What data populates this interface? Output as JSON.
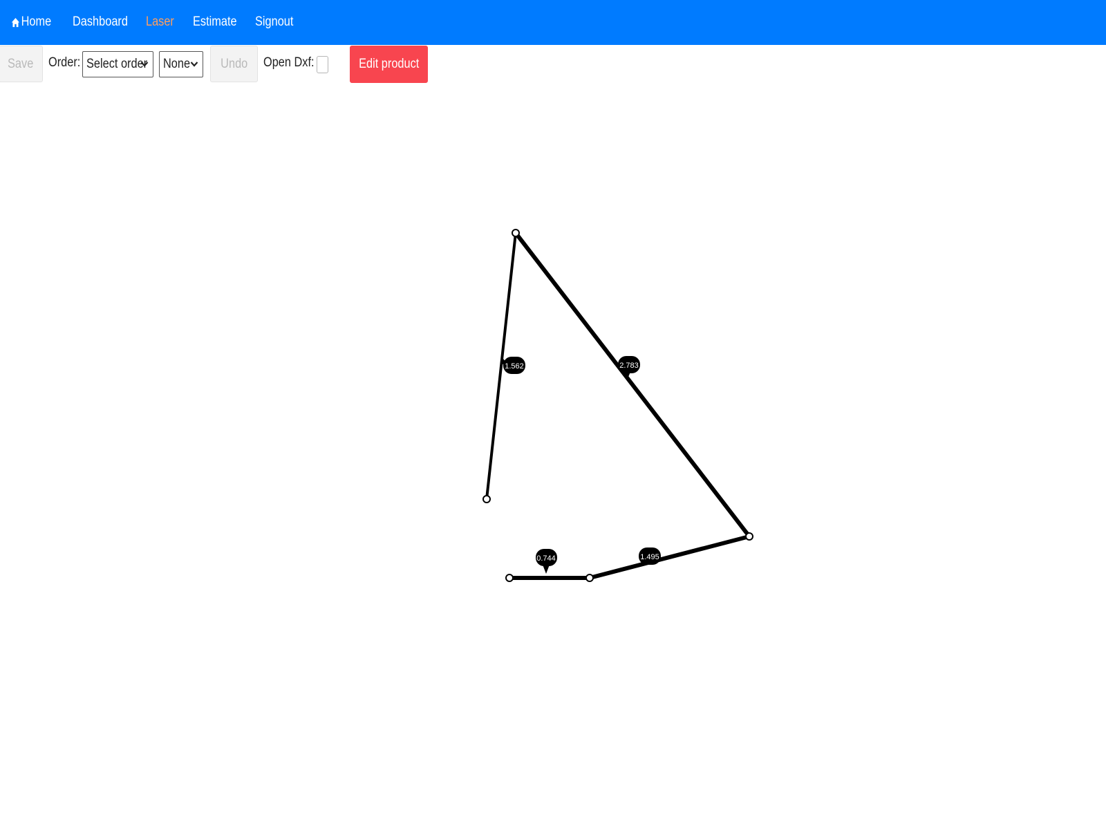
{
  "nav": {
    "items": [
      {
        "label": "Home",
        "icon": "home-icon",
        "active": false
      },
      {
        "label": "Dashboard",
        "active": false
      },
      {
        "label": "Laser",
        "active": true
      },
      {
        "label": "Estimate",
        "active": false
      },
      {
        "label": "Signout",
        "active": false
      }
    ],
    "background_color": "#007bff",
    "active_color": "#ff9f5f"
  },
  "toolbar": {
    "save_label": "Save",
    "order_label": "Order:",
    "order_select_value": "Select order",
    "second_select_value": "None",
    "undo_label": "Undo",
    "open_dxf_label": "Open Dxf:",
    "open_dxf_checked": false,
    "edit_product_label": "Edit product",
    "edit_product_color": "#f8454f"
  },
  "drawing": {
    "segments": [
      {
        "label": "1.562"
      },
      {
        "label": "2.783"
      },
      {
        "label": "1.495"
      },
      {
        "label": "0.744"
      }
    ]
  }
}
